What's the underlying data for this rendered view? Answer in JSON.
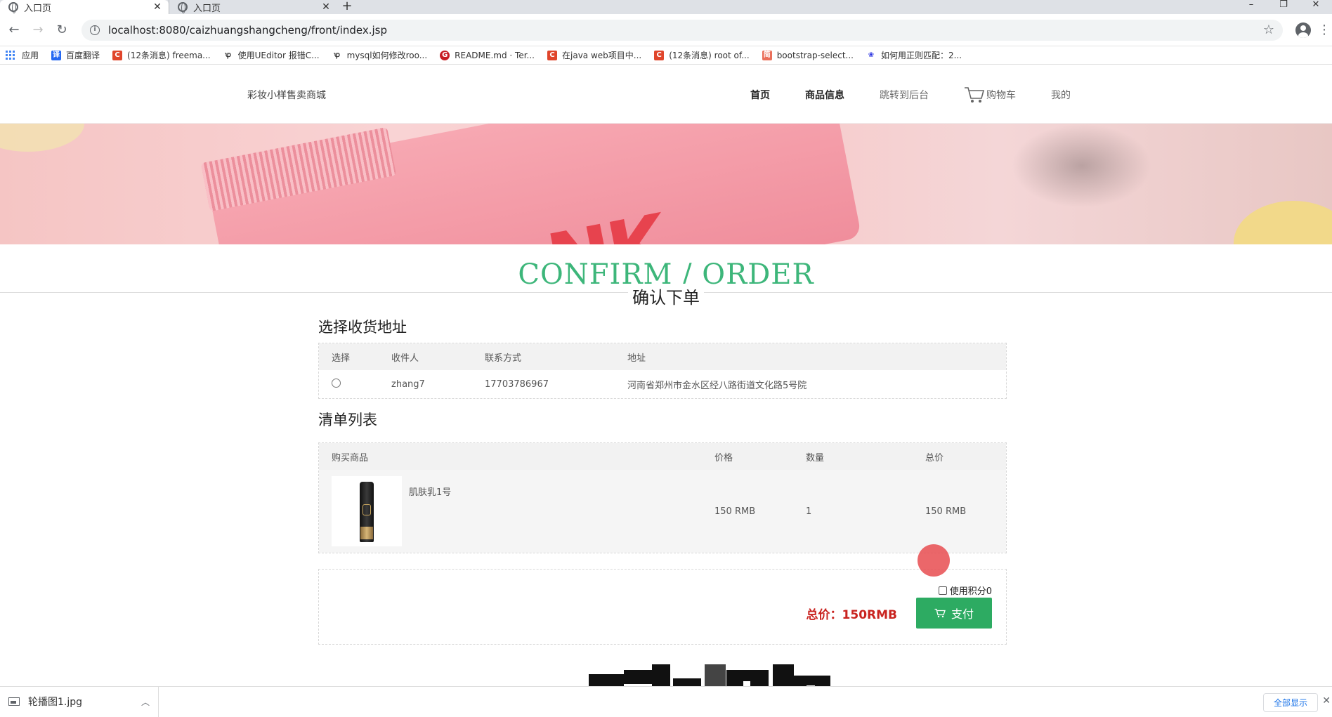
{
  "browser": {
    "tabs": [
      {
        "title": "入口页",
        "active": true
      },
      {
        "title": "入口页",
        "active": false
      }
    ],
    "url": "localhost:8080/caizhuangshangcheng/front/index.jsp",
    "bookmarks": [
      {
        "label": "应用",
        "icon": "apps-grid-icon"
      },
      {
        "label": "百度翻译",
        "icon": "baidu-translate-icon",
        "color": "#2468f2"
      },
      {
        "label": "(12条消息) freema...",
        "icon": "csdn-icon",
        "color": "#e0452b"
      },
      {
        "label": "使用UEditor 报错C...",
        "icon": "ueditor-icon",
        "color": "#333333"
      },
      {
        "label": "mysql如何修改roo...",
        "icon": "ueditor-icon",
        "color": "#333333"
      },
      {
        "label": "README.md · Ter...",
        "icon": "gitee-icon",
        "color": "#c71d23"
      },
      {
        "label": "在java web项目中...",
        "icon": "csdn-icon",
        "color": "#e0452b"
      },
      {
        "label": "(12条消息) root of...",
        "icon": "csdn-icon",
        "color": "#e0452b"
      },
      {
        "label": "bootstrap-select...",
        "icon": "jianshu-icon",
        "color": "#ea6f5a"
      },
      {
        "label": "如何用正则匹配：2...",
        "icon": "baidu-paw-icon",
        "color": "#2932e1"
      }
    ]
  },
  "header": {
    "logo": "彩妆小样售卖商城",
    "nav": {
      "home": "首页",
      "products": "商品信息",
      "admin": "跳转到后台",
      "cart": "购物车",
      "mine": "我的"
    }
  },
  "page": {
    "title_en": "CONFIRM / ORDER",
    "title_cn": "确认下单"
  },
  "address": {
    "section_title": "选择收货地址",
    "headers": {
      "select": "选择",
      "receiver": "收件人",
      "phone": "联系方式",
      "address": "地址"
    },
    "rows": [
      {
        "receiver": "zhang7",
        "phone": "17703786967",
        "address": "河南省郑州市金水区经八路街道文化路5号院"
      }
    ]
  },
  "order_list": {
    "section_title": "清单列表",
    "headers": {
      "product": "购买商品",
      "price": "价格",
      "quantity": "数量",
      "total": "总价"
    },
    "rows": [
      {
        "name": "肌肤乳1号",
        "price": "150 RMB",
        "quantity": "1",
        "total": "150 RMB"
      }
    ]
  },
  "payment": {
    "use_points_label": "使用积分0",
    "total_label": "总价：150RMB",
    "pay_button": "支付",
    "accent_color": "#2dab62",
    "total_color": "#c9231f"
  },
  "download_bar": {
    "file_name": "轮播图1.jpg",
    "show_all": "全部显示"
  }
}
